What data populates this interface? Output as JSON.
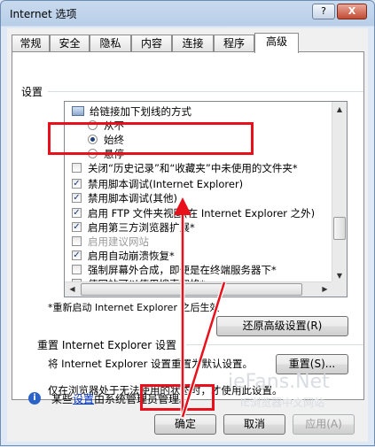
{
  "window": {
    "title": "Internet 选项",
    "help_label": "?",
    "close_label": "X"
  },
  "tabs": [
    {
      "label": "常规"
    },
    {
      "label": "安全"
    },
    {
      "label": "隐私"
    },
    {
      "label": "内容"
    },
    {
      "label": "连接"
    },
    {
      "label": "程序"
    },
    {
      "label": "高级",
      "active": true
    }
  ],
  "settings": {
    "section_label": "设置",
    "items": [
      {
        "type": "folder",
        "label": "给链接加下划线的方式"
      },
      {
        "type": "radio",
        "label": "从不",
        "checked": false
      },
      {
        "type": "radio",
        "label": "始终",
        "checked": true
      },
      {
        "type": "radio",
        "label": "悬停",
        "checked": false
      },
      {
        "type": "checkbox",
        "label": "关闭“历史记录”和“收藏夹”中未使用的文件夹*",
        "checked": false
      },
      {
        "type": "checkbox",
        "label": "禁用脚本调试(Internet Explorer)",
        "checked": true
      },
      {
        "type": "checkbox",
        "label": "禁用脚本调试(其他)",
        "checked": true
      },
      {
        "type": "checkbox",
        "label": "启用 FTP 文件夹视图(在 Internet Explorer 之外)",
        "checked": true
      },
      {
        "type": "checkbox",
        "label": "启用第三方浏览器扩展*",
        "checked": true
      },
      {
        "type": "checkbox",
        "label": "启用建议网站",
        "checked": false,
        "disabled": true
      },
      {
        "type": "checkbox",
        "label": "启用自动崩溃恢复*",
        "checked": true
      },
      {
        "type": "checkbox",
        "label": "强制屏幕外合成，即便是在终端服务器下*",
        "checked": false
      },
      {
        "type": "checkbox",
        "label": "使网站可以使用搜索窗格*",
        "checked": false
      }
    ],
    "restart_note": "*重新启动 Internet Explorer 之后生效",
    "restore_button": "还原高级设置(R)"
  },
  "reset": {
    "title": "重置 Internet Explorer 设置",
    "description": "将 Internet Explorer 设置重置为默认设置。",
    "button": "重置(S)...",
    "note": "仅在浏览器处于无法使用的状态时，才使用此设置。"
  },
  "info": {
    "icon": "info-icon",
    "prefix": "某些",
    "link": "设置",
    "suffix": "由系统管理员管理。"
  },
  "footer": {
    "ok": "确定",
    "cancel": "取消",
    "apply": "应用(A)"
  },
  "watermark": {
    "site": "ieFans.Net",
    "subtitle": "IE浏览器中文网站"
  },
  "colors": {
    "annotation_red": "#e8101a",
    "link_blue": "#0033cc"
  }
}
